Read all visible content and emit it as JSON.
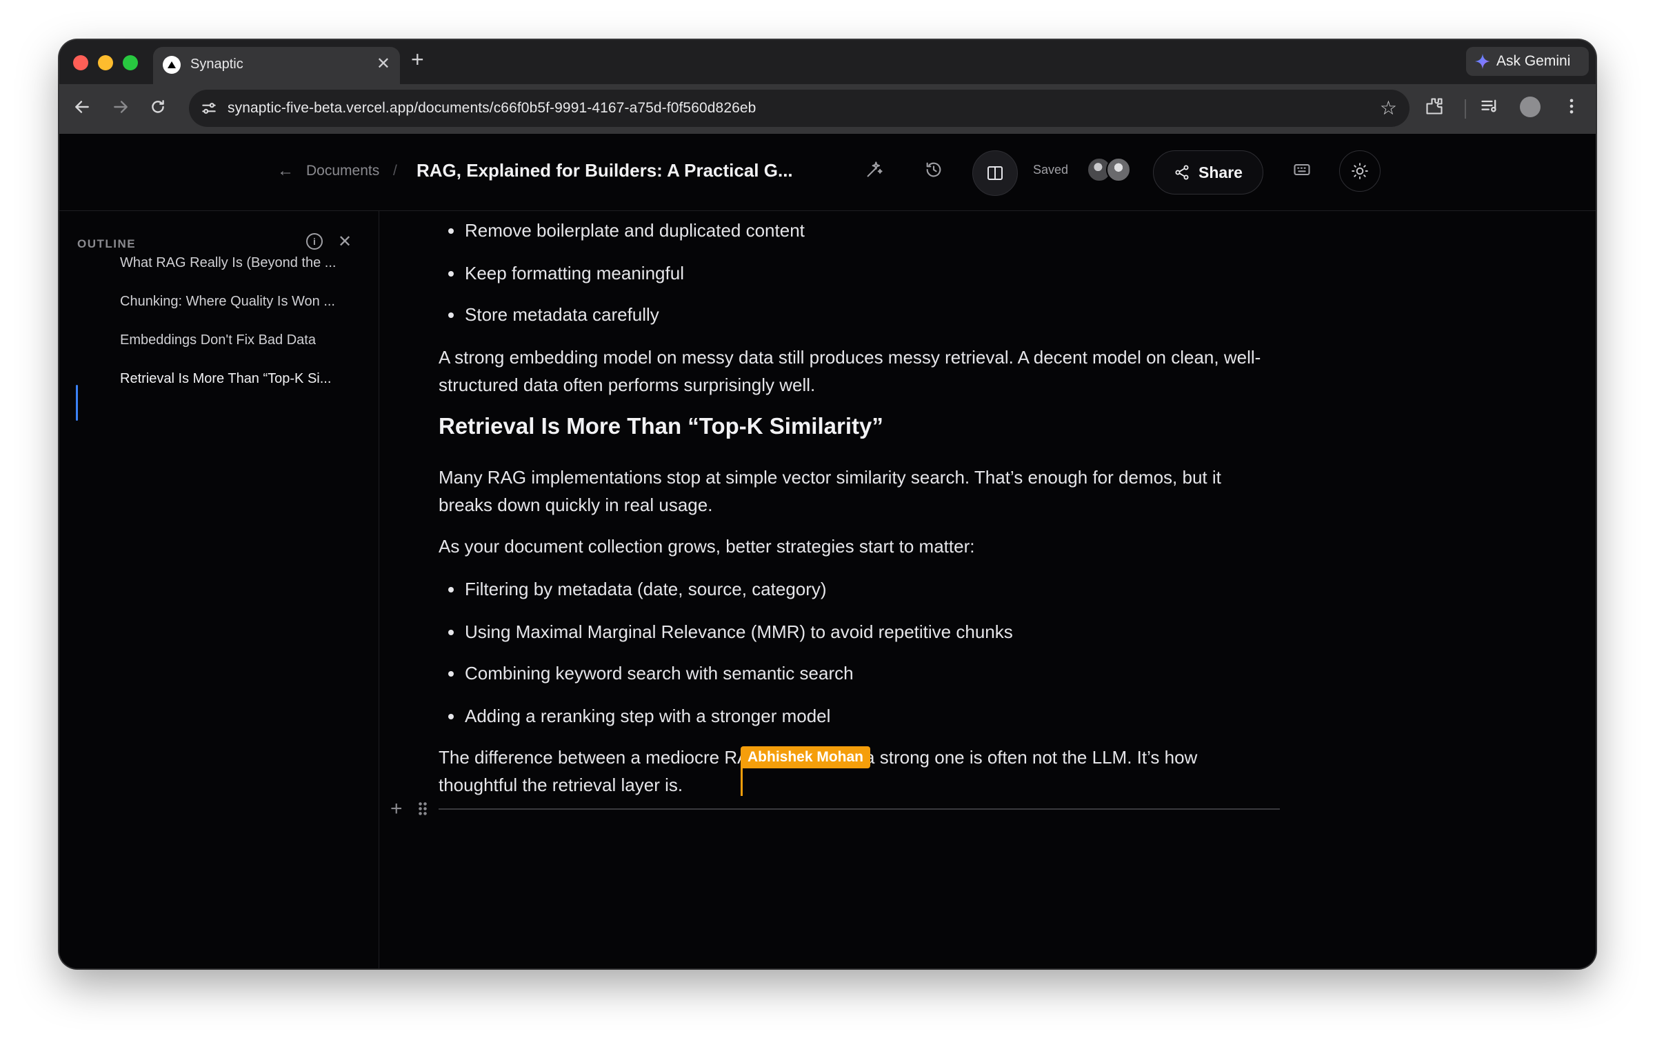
{
  "browser": {
    "tab_title": "Synaptic",
    "tab_close": "✕",
    "new_tab": "+",
    "ask_gemini": "Ask Gemini",
    "url": "synaptic-five-beta.vercel.app/documents/c66f0b5f-9991-4167-a75d-f0f560d826eb"
  },
  "header": {
    "breadcrumb_back": "←",
    "breadcrumb": "Documents",
    "breadcrumb_sep": "/",
    "title": "RAG, Explained for Builders: A Practical G...",
    "saved": "Saved",
    "share": "Share"
  },
  "outline": {
    "label": "OUTLINE",
    "items": [
      {
        "label": "What RAG Really Is (Beyond the ..."
      },
      {
        "label": "Chunking: Where Quality Is Won ..."
      },
      {
        "label": "Embeddings Don't Fix Bad Data"
      },
      {
        "label": "Retrieval Is More Than “Top-K Si..."
      }
    ]
  },
  "document": {
    "bullets_top": [
      "Remove boilerplate and duplicated content",
      "Keep formatting meaningful",
      "Store metadata carefully"
    ],
    "para1": "A strong embedding model on messy data still produces messy retrieval. A decent model on clean, well-structured data often performs surprisingly well.",
    "heading": "Retrieval Is More Than “Top-K Similarity”",
    "para2": "Many RAG implementations stop at simple vector similarity search. That’s enough for demos, but it breaks down quickly in real usage.",
    "para3": "As your document collection grows, better strategies start to matter:",
    "bullets_bottom": [
      "Filtering by metadata (date, source, category)",
      "Using Maximal Marginal Relevance (MMR) to avoid repetitive chunks",
      "Combining keyword search with semantic search",
      "Adding a reranking step with a stronger model"
    ],
    "para4": "The difference between a mediocre RAG system and a strong one is often not the LLM. It’s how thoughtful the retrieval layer is.",
    "collaborator_cursor": "Abhishek Mohan"
  },
  "colors": {
    "accent_outline": "#3b82f6",
    "collaborator": "#f59e0b",
    "background": "#050507"
  }
}
